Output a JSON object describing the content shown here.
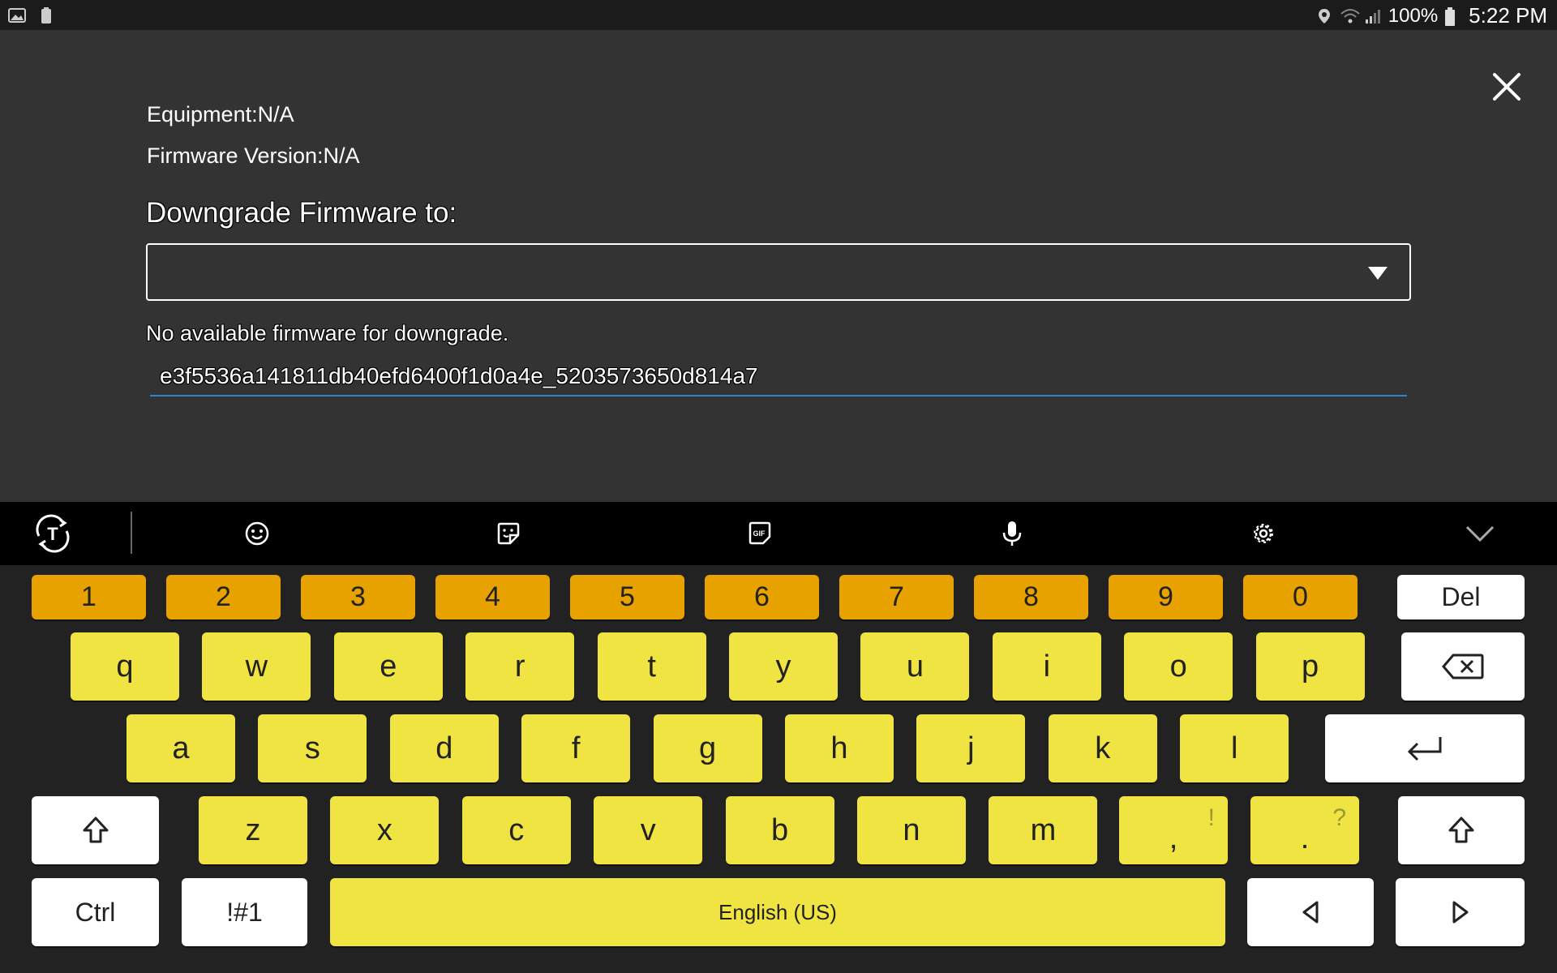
{
  "status_bar": {
    "battery": "100%",
    "time": "5:22 PM",
    "left_icons": [
      "gallery-icon",
      "battery-saver-icon"
    ],
    "right_icons": [
      "location-icon",
      "wifi-icon",
      "signal-icon",
      "battery-icon"
    ]
  },
  "dialog": {
    "equipment": "Equipment:N/A",
    "firmware_version": "Firmware Version:N/A",
    "downgrade_heading": "Downgrade Firmware to:",
    "select_value": "",
    "no_firmware_message": "No available firmware for downgrade.",
    "code_value": "e3f5536a141811db40efd6400f1d0a4e_5203573650d814a7"
  },
  "keyboard_toolbar": {
    "items": [
      "text-mode-icon",
      "emoji-icon",
      "sticker-icon",
      "gif-icon",
      "microphone-icon",
      "settings-icon",
      "chevron-down-icon"
    ]
  },
  "keyboard": {
    "number_row": [
      "1",
      "2",
      "3",
      "4",
      "5",
      "6",
      "7",
      "8",
      "9",
      "0"
    ],
    "del_label": "Del",
    "row1": [
      "q",
      "w",
      "e",
      "r",
      "t",
      "y",
      "u",
      "i",
      "o",
      "p"
    ],
    "row2": [
      "a",
      "s",
      "d",
      "f",
      "g",
      "h",
      "j",
      "k",
      "l"
    ],
    "row3": [
      "z",
      "x",
      "c",
      "v",
      "b",
      "n",
      "m"
    ],
    "comma": ",",
    "comma_alt": "!",
    "period": ".",
    "period_alt": "?",
    "ctrl_label": "Ctrl",
    "symbols_label": "!#1",
    "space_label": "English (US)",
    "colors": {
      "number_keys": "#e8a200",
      "letter_keys": "#f0e443",
      "special_keys": "#ffffff"
    }
  }
}
